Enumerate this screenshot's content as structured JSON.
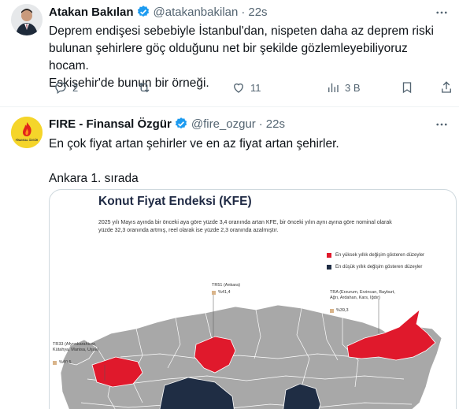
{
  "tweets": [
    {
      "name": "Atakan Bakılan",
      "handle": "@atakanbakilan",
      "time": "22s",
      "text": "Deprem endişesi sebebiyle İstanbul'dan, nispeten daha az deprem riski\nbulunan şehirlere göç olduğunu net bir şekilde gözlemleyebiliyoruz hocam.\nEskişehir'de bunun bir örneği.",
      "replies": "2",
      "likes": "11",
      "views": "3 B"
    },
    {
      "name": "FIRE - Finansal Özgür",
      "handle": "@fire_ozgur",
      "time": "22s",
      "text": "En çok fiyat artan şehirler ve en az fiyat artan şehirler.\n\nAnkara 1. sırada",
      "avatar_text": "FİNANSAL ÖZGÜR"
    }
  ],
  "infographic": {
    "title": "Konut Fiyat Endeksi (KFE)",
    "description": "2025 yılı Mayıs ayında bir önceki aya göre yüzde 3,4 oranında artan KFE, bir önceki yılın aynı ayına göre nominal olarak yüzde 32,3 oranında artmış, reel olarak ise yüzde 2,3 oranında azalmıştır.",
    "legend_high": "En yüksek yıllık değişim gösteren düzeyler",
    "legend_low": "En düşük yıllık değişim gösteren düzeyler",
    "labels": [
      {
        "region": "TR51 (Ankara)",
        "value": "%41,4"
      },
      {
        "region": "TRA (Erzurum, Erzincan, Bayburt,\nAğrı, Ardahan, Kars, Iğdır)",
        "value": "%39,3"
      },
      {
        "region": "TR33 (Afyonkarahisar,\nKütahya, Manisa, Uşak)",
        "value": "%40,5"
      }
    ]
  },
  "colors": {
    "high": "#e0192c",
    "low": "#1f2d44",
    "neutral": "#a8a8a8",
    "verified": "#1d9bf0",
    "muted": "#536471"
  }
}
